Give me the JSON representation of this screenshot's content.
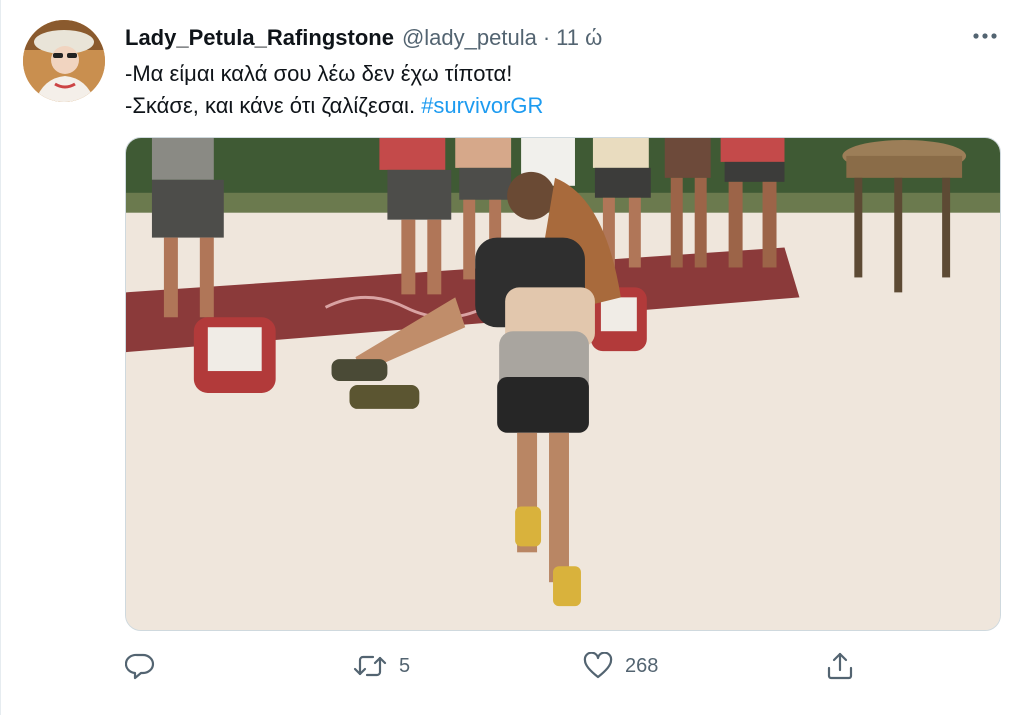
{
  "tweet": {
    "display_name": "Lady_Petula_Rafingstone",
    "handle": "@lady_petula",
    "separator": "·",
    "time": "11 ώ",
    "text_line1": "-Μα είμαι καλά σου λέω δεν έχω τίποτα!",
    "text_line2_prefix": "-Σκάσε, και κάνε ότι ζαλίζεσαι.",
    "hashtag": "#survivorGR"
  },
  "actions": {
    "reply_count": "",
    "retweet_count": "5",
    "like_count": "268",
    "share_count": ""
  },
  "icons": {
    "more": "more-horizontal-icon",
    "reply": "reply-icon",
    "retweet": "retweet-icon",
    "like": "heart-icon",
    "share": "share-icon"
  },
  "colors": {
    "text_primary": "#0f1419",
    "text_secondary": "#536471",
    "link": "#1d9bf0",
    "border": "#cfd9de"
  }
}
